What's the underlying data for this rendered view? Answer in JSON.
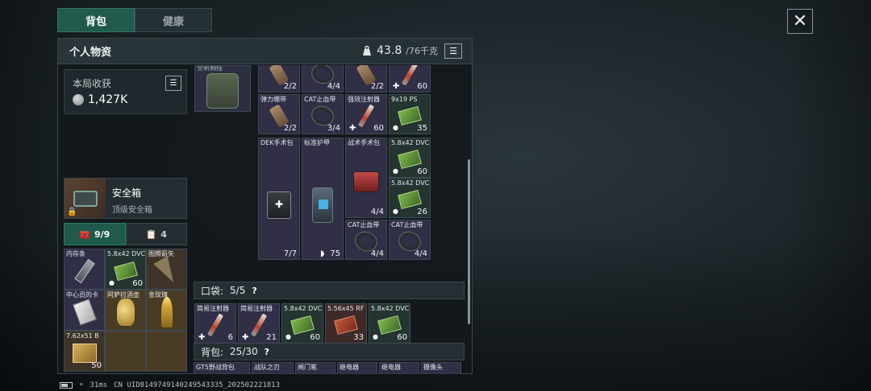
{
  "tabs": [
    {
      "label": "背包",
      "active": true
    },
    {
      "label": "健康",
      "active": false
    }
  ],
  "close": {
    "icon": "close-icon",
    "glyph": "✕"
  },
  "panel": {
    "title": "个人物资",
    "weight_value": "43.8",
    "weight_max": "/76千克",
    "weight_icon": "weight-icon",
    "list_glyph": "☰"
  },
  "earnings": {
    "label": "本局收获",
    "value": "1,427K"
  },
  "safe_box": {
    "title": "安全箱",
    "subtitle": "顶级安全箱",
    "lock_glyph": "🔒"
  },
  "safe_tabs": [
    {
      "label": "9/9",
      "icon": "toolbox-icon",
      "glyph": "🧰",
      "active": true
    },
    {
      "label": "4",
      "icon": "clipboard-icon",
      "glyph": "📋",
      "active": false
    }
  ],
  "safe_items": [
    {
      "name": "内存条",
      "count": "",
      "color": "purple",
      "shape": "drive"
    },
    {
      "name": "5.8x42 DVC",
      "count": "60",
      "color": "green",
      "shape": "ammo-box",
      "dot": true
    },
    {
      "name": "图腾箭矢",
      "count": "",
      "color": "brown",
      "shape": "arrowhead"
    },
    {
      "name": "中心员的卡",
      "count": "",
      "color": "purple",
      "shape": "card"
    },
    {
      "name": "阿萨拉酒壶",
      "count": "",
      "color": "gold",
      "shape": "jug"
    },
    {
      "name": "金玫瑰",
      "count": "",
      "color": "gold",
      "shape": "rose"
    },
    {
      "name": "7.62x51 B",
      "count": "50",
      "color": "brown",
      "shape": "crate"
    }
  ],
  "gear": {
    "name": "全新胸挂"
  },
  "top_items": [
    {
      "name": "",
      "count": "2/2",
      "color": "purple",
      "shape": "bandage"
    },
    {
      "name": "",
      "count": "4/4",
      "color": "purple",
      "shape": "tourniquet"
    },
    {
      "name": "",
      "count": "2/2",
      "color": "purple",
      "shape": "bandage"
    },
    {
      "name": "",
      "count": "60",
      "color": "purple",
      "shape": "syringe",
      "plus": true
    },
    {
      "name": "弹力绷带",
      "count": "2/2",
      "color": "purple",
      "shape": "bandage"
    },
    {
      "name": "CAT止血带",
      "count": "3/4",
      "color": "purple",
      "shape": "tourniquet"
    },
    {
      "name": "强效注射器",
      "count": "60",
      "color": "purple",
      "shape": "syringe",
      "plus": true
    },
    {
      "name": "9x19 PS",
      "count": "35",
      "color": "green",
      "shape": "ammo-box",
      "dot": true
    }
  ],
  "mid_items": [
    {
      "name": "DEK手术包",
      "count": "7/7",
      "color": "purple",
      "shape": "medkit"
    },
    {
      "name": "标准护甲",
      "count": "75",
      "color": "purple",
      "shape": "armor",
      "shield": true
    },
    {
      "name": "战术手术包",
      "count": "4/4",
      "color": "purple",
      "shape": "medkit-red"
    },
    {
      "name": "5.8x42 DVC",
      "count": "60",
      "color": "green",
      "shape": "ammo-box",
      "dot": true
    },
    {
      "name": "5.8x42 DVC",
      "count": "26",
      "color": "green",
      "shape": "ammo-box",
      "dot": true
    },
    {
      "name": "CAT止血带",
      "count": "4/4",
      "color": "purple",
      "shape": "tourniquet"
    },
    {
      "name": "CAT止血带",
      "count": "4/4",
      "color": "purple",
      "shape": "tourniquet"
    }
  ],
  "pocket": {
    "label": "口袋:",
    "value": "5/5",
    "help": "?",
    "items": [
      {
        "name": "简易注射器",
        "count": "6",
        "color": "purple",
        "shape": "syringe",
        "plus": true
      },
      {
        "name": "简易注射器",
        "count": "21",
        "color": "purple",
        "shape": "syringe",
        "plus": true
      },
      {
        "name": "5.8x42 DVC",
        "count": "60",
        "color": "green",
        "shape": "ammo-box",
        "dot": true
      },
      {
        "name": "5.56x45 RF",
        "count": "33",
        "color": "red",
        "shape": "ammo-red"
      },
      {
        "name": "5.8x42 DVC",
        "count": "60",
        "color": "green",
        "shape": "ammo-box",
        "dot": true
      }
    ]
  },
  "backpack": {
    "label": "背包:",
    "value": "25/30",
    "help": "?",
    "items": [
      {
        "name": "GT5野战背包"
      },
      {
        "name": "战队之刃"
      },
      {
        "name": "闸门笔"
      },
      {
        "name": "继电器"
      },
      {
        "name": "继电器"
      },
      {
        "name": "摄像头"
      }
    ]
  },
  "status": {
    "ping": "31ms",
    "uid": "CN UID8149749140249543335_202502221813"
  }
}
